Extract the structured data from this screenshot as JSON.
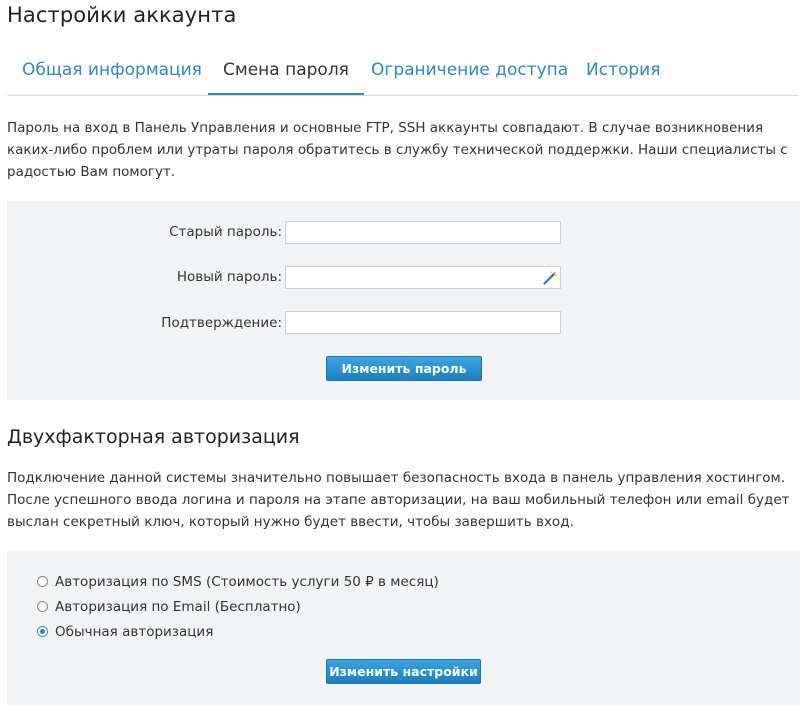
{
  "page_title": "Настройки аккаунта",
  "tabs": [
    {
      "label": "Общая информация",
      "active": false
    },
    {
      "label": "Смена пароля",
      "active": true
    },
    {
      "label": "Ограничение доступа",
      "active": false
    },
    {
      "label": "История",
      "active": false
    }
  ],
  "password": {
    "intro": "Пароль на вход в Панель Управления и основные FTP, SSH аккаунты совпадают. В случае возникновения каких-либо проблем или утраты пароля обратитесь в службу технической поддержки. Наши специалисты с радостью Вам помогут.",
    "fields": [
      {
        "label": "Старый пароль:",
        "value": ""
      },
      {
        "label": "Новый пароль:",
        "value": ""
      },
      {
        "label": "Подтверждение:",
        "value": ""
      }
    ],
    "submit_label": "Изменить пароль"
  },
  "twofa": {
    "title": "Двухфакторная авторизация",
    "description": "Подключение данной системы значительно повышает безопасность входа в панель управления хостингом. После успешного ввода логина и пароля на этапе авторизации, на ваш мобильный телефон или email будет выслан секретный ключ, который нужно будет ввести, чтобы завершить вход.",
    "options": [
      {
        "label": "Авторизация по SMS (Стоимость услуги 50 ₽ в месяц)",
        "selected": false
      },
      {
        "label": "Авторизация по Email (Бесплатно)",
        "selected": false
      },
      {
        "label": "Обычная авторизация",
        "selected": true
      }
    ],
    "submit_label": "Изменить настройки"
  },
  "colors": {
    "accent": "#2a8bc8",
    "button": "#1a7fc2",
    "panel_bg": "#f1f3f5"
  },
  "icons": {
    "password_generator": "magic-wand-icon"
  }
}
